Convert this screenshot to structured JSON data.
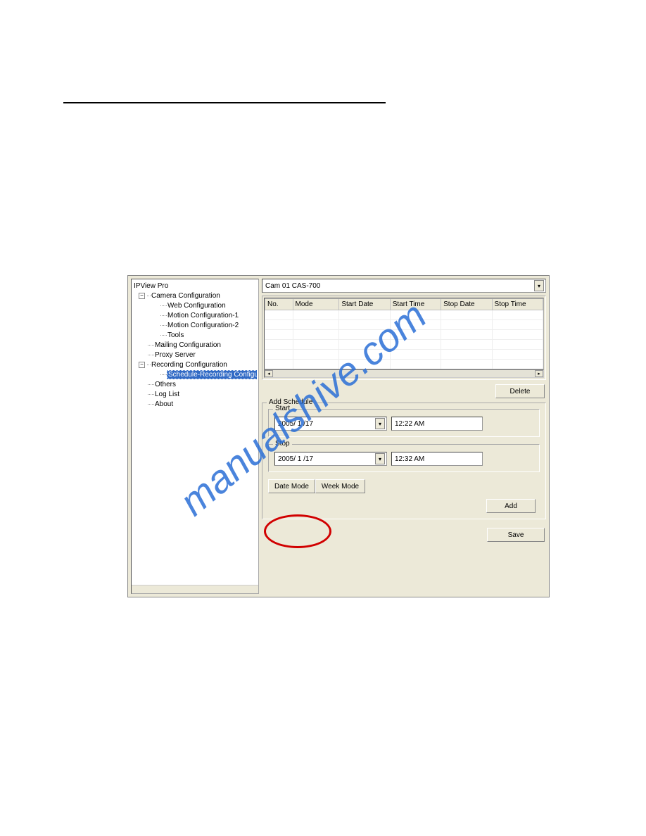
{
  "watermark": "manualshive.com",
  "tree": {
    "root": "IPView Pro",
    "items": {
      "camera": "Camera Configuration",
      "camera_children": {
        "web": "Web Configuration",
        "motion1": "Motion Configuration-1",
        "motion2": "Motion Configuration-2",
        "tools": "Tools"
      },
      "mailing": "Mailing Configuration",
      "proxy": "Proxy Server",
      "recording": "Recording Configuration",
      "recording_children": {
        "schedule": "Schedule-Recording Configur"
      },
      "others": "Others",
      "loglist": "Log List",
      "about": "About"
    }
  },
  "camera_select": "Cam 01     CAS-700",
  "grid_headers": [
    "No.",
    "Mode",
    "Start Date",
    "Start Time",
    "Stop Date",
    "Stop Time"
  ],
  "buttons": {
    "delete": "Delete",
    "add": "Add",
    "save": "Save"
  },
  "schedule_group": {
    "legend": "Add Schedule",
    "start_label": "Start",
    "stop_label": "Stop",
    "start_date": "2005/ 1 /17",
    "start_time": "12:22 AM",
    "stop_date": "2005/ 1 /17",
    "stop_time": "12:32 AM",
    "tab_date": "Date Mode",
    "tab_week": "Week Mode"
  }
}
